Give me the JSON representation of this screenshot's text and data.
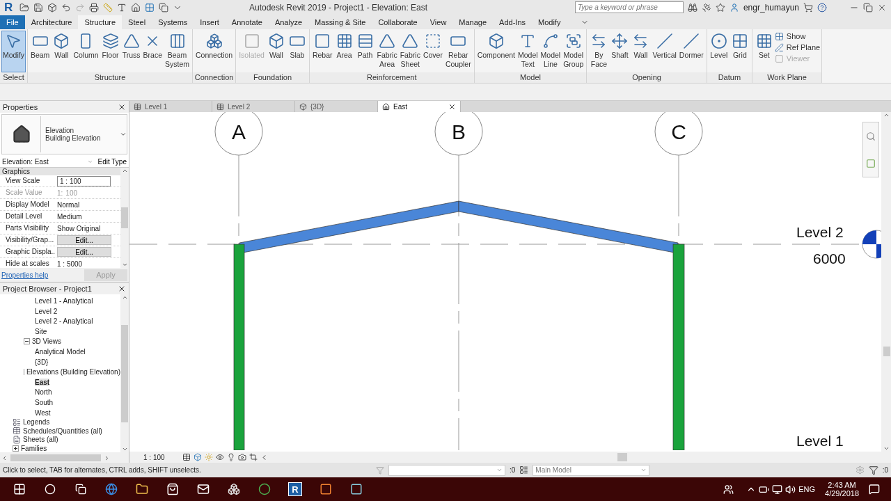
{
  "title_bar": {
    "logo": "R",
    "title": "Autodesk Revit 2019 - Project1 - Elevation: East",
    "search": {
      "placeholder": "Type a keyword or phrase"
    },
    "user": "engr_humayun"
  },
  "ribbon_tabs": [
    {
      "label": "File",
      "kind": "file",
      "selected": false
    },
    {
      "label": "Architecture",
      "kind": "tab",
      "selected": false
    },
    {
      "label": "Structure",
      "kind": "tab",
      "selected": true
    },
    {
      "label": "Steel",
      "kind": "tab",
      "selected": false
    },
    {
      "label": "Systems",
      "kind": "tab",
      "selected": false
    },
    {
      "label": "Insert",
      "kind": "tab",
      "selected": false
    },
    {
      "label": "Annotate",
      "kind": "tab",
      "selected": false
    },
    {
      "label": "Analyze",
      "kind": "tab",
      "selected": false
    },
    {
      "label": "Massing & Site",
      "kind": "tab",
      "selected": false
    },
    {
      "label": "Collaborate",
      "kind": "tab",
      "selected": false
    },
    {
      "label": "View",
      "kind": "tab",
      "selected": false
    },
    {
      "label": "Manage",
      "kind": "tab",
      "selected": false
    },
    {
      "label": "Add-Ins",
      "kind": "tab",
      "selected": false
    },
    {
      "label": "Modify",
      "kind": "tab",
      "selected": false
    }
  ],
  "ribbon_panels": [
    {
      "label": "Select",
      "tools": [
        {
          "label": "Modify",
          "kind": "large",
          "selected": true,
          "disabled": false
        }
      ]
    },
    {
      "label": "Structure",
      "tools": [
        {
          "label": "Beam",
          "kind": "large",
          "selected": false,
          "disabled": false
        },
        {
          "label": "Wall",
          "kind": "large",
          "selected": false,
          "disabled": false
        },
        {
          "label": "Column",
          "kind": "large",
          "selected": false,
          "disabled": false
        },
        {
          "label": "Floor",
          "kind": "large",
          "selected": false,
          "disabled": false
        },
        {
          "label": "Truss",
          "kind": "large",
          "selected": false,
          "disabled": false
        },
        {
          "label": "Brace",
          "kind": "large",
          "selected": false,
          "disabled": false
        },
        {
          "label": "Beam System",
          "kind": "large",
          "selected": false,
          "disabled": false
        }
      ]
    },
    {
      "label": "Connection",
      "tools": [
        {
          "label": "Connection",
          "kind": "large",
          "selected": false,
          "disabled": false
        }
      ]
    },
    {
      "label": "Foundation",
      "tools": [
        {
          "label": "Isolated",
          "kind": "large",
          "selected": false,
          "disabled": true
        },
        {
          "label": "Wall",
          "kind": "large",
          "selected": false,
          "disabled": false
        },
        {
          "label": "Slab",
          "kind": "large",
          "selected": false,
          "disabled": false
        }
      ]
    },
    {
      "label": "Reinforcement",
      "tools": [
        {
          "label": "Rebar",
          "kind": "large",
          "selected": false,
          "disabled": false
        },
        {
          "label": "Area",
          "kind": "large",
          "selected": false,
          "disabled": false
        },
        {
          "label": "Path",
          "kind": "large",
          "selected": false,
          "disabled": false
        },
        {
          "label": "Fabric Area",
          "kind": "large",
          "selected": false,
          "disabled": false
        },
        {
          "label": "Fabric Sheet",
          "kind": "large",
          "selected": false,
          "disabled": false
        },
        {
          "label": "Cover",
          "kind": "large",
          "selected": false,
          "disabled": false
        },
        {
          "label": "Rebar Coupler",
          "kind": "large",
          "selected": false,
          "disabled": false
        }
      ]
    },
    {
      "label": "Model",
      "tools": [
        {
          "label": "Component",
          "kind": "large",
          "selected": false,
          "disabled": false
        },
        {
          "label": "Model Text",
          "kind": "large",
          "selected": false,
          "disabled": false
        },
        {
          "label": "Model Line",
          "kind": "large",
          "selected": false,
          "disabled": false
        },
        {
          "label": "Model Group",
          "kind": "large",
          "selected": false,
          "disabled": false
        }
      ]
    },
    {
      "label": "Opening",
      "tools": [
        {
          "label": "By Face",
          "kind": "large",
          "selected": false,
          "disabled": false
        },
        {
          "label": "Shaft",
          "kind": "large",
          "selected": false,
          "disabled": false
        },
        {
          "label": "Wall",
          "kind": "large",
          "selected": false,
          "disabled": false
        },
        {
          "label": "Vertical",
          "kind": "large",
          "selected": false,
          "disabled": false
        },
        {
          "label": "Dormer",
          "kind": "large",
          "selected": false,
          "disabled": false
        }
      ]
    },
    {
      "label": "Datum",
      "tools": [
        {
          "label": "Level",
          "kind": "large",
          "selected": false,
          "disabled": false
        },
        {
          "label": "Grid",
          "kind": "large",
          "selected": false,
          "disabled": false
        }
      ]
    },
    {
      "label": "Work Plane",
      "tools": [
        {
          "label": "Set",
          "kind": "large",
          "selected": false,
          "disabled": false
        },
        {
          "label": "Show",
          "kind": "small",
          "selected": false,
          "disabled": false
        },
        {
          "label": "Ref Plane",
          "kind": "small",
          "selected": false,
          "disabled": false
        },
        {
          "label": "Viewer",
          "kind": "small",
          "selected": false,
          "disabled": true
        }
      ]
    }
  ],
  "properties": {
    "title": "Properties",
    "type_name": "Elevation",
    "type_sub": "Building Elevation",
    "instance": "Elevation: East",
    "edit_type": "Edit Type",
    "group": "Graphics",
    "rows": [
      {
        "name": "View Scale",
        "value": "1 : 100",
        "kind": "input",
        "disabled": false
      },
      {
        "name": "Scale Value",
        "prefix": "1:",
        "value": "100",
        "kind": "text",
        "disabled": true
      },
      {
        "name": "Display Model",
        "value": "Normal",
        "kind": "text",
        "disabled": false
      },
      {
        "name": "Detail Level",
        "value": "Medium",
        "kind": "text",
        "disabled": false
      },
      {
        "name": "Parts Visibility",
        "value": "Show Original",
        "kind": "text",
        "disabled": false
      },
      {
        "name": "Visibility/Grap...",
        "value": "Edit...",
        "kind": "button",
        "disabled": false
      },
      {
        "name": "Graphic Displa...",
        "value": "Edit...",
        "kind": "button",
        "disabled": false
      },
      {
        "name": "Hide at scales",
        "value": "1 : 5000",
        "kind": "text",
        "disabled": false
      }
    ],
    "help": "Properties help",
    "apply": {
      "label": "Apply",
      "disabled": true
    }
  },
  "browser": {
    "title": "Project Browser - Project1",
    "items": [
      {
        "children": [
          {
            "children": [
              {
                "label": "Level 1 - Analytical",
                "selected": false
              },
              {
                "label": "Level 2",
                "selected": false
              },
              {
                "label": "Level 2 - Analytical",
                "selected": false
              },
              {
                "label": "Site",
                "selected": false
              }
            ]
          },
          {
            "label": "3D Views",
            "expanded": true,
            "selected": false,
            "children": [
              {
                "label": "Analytical Model",
                "selected": false
              },
              {
                "label": "{3D}",
                "selected": false
              }
            ]
          },
          {
            "label": "Elevations (Building Elevation)",
            "expanded": true,
            "selected": false,
            "children": [
              {
                "label": "East",
                "selected": true
              },
              {
                "label": "North",
                "selected": false
              },
              {
                "label": "South",
                "selected": false
              },
              {
                "label": "West",
                "selected": false
              }
            ]
          }
        ]
      },
      {
        "label": "Legends",
        "selected": false
      },
      {
        "label": "Schedules/Quantities (all)",
        "selected": false
      },
      {
        "label": "Sheets (all)",
        "selected": false
      },
      {
        "label": "Families",
        "expanded": false,
        "selected": false
      }
    ]
  },
  "view_tabs": [
    {
      "label": "Level 1",
      "selected": false
    },
    {
      "label": "Level 2",
      "selected": false
    },
    {
      "label": "{3D}",
      "selected": false
    },
    {
      "label": "East",
      "selected": true
    }
  ],
  "canvas": {
    "grids": [
      "A",
      "B",
      "C"
    ],
    "levels": [
      {
        "name": "Level 2",
        "elevation": "6000"
      },
      {
        "name": "Level 1"
      }
    ]
  },
  "view_bar": {
    "scale": "1 : 100"
  },
  "status_bar": {
    "message": "Click to select, TAB for alternates, CTRL adds, SHIFT unselects.",
    "count_left": ":0",
    "model": "Main Model",
    "count_right": ":0"
  },
  "taskbar": {
    "revit_icon": "R",
    "lang": "ENG",
    "time": "2:43 AM",
    "date": "4/29/2018"
  }
}
